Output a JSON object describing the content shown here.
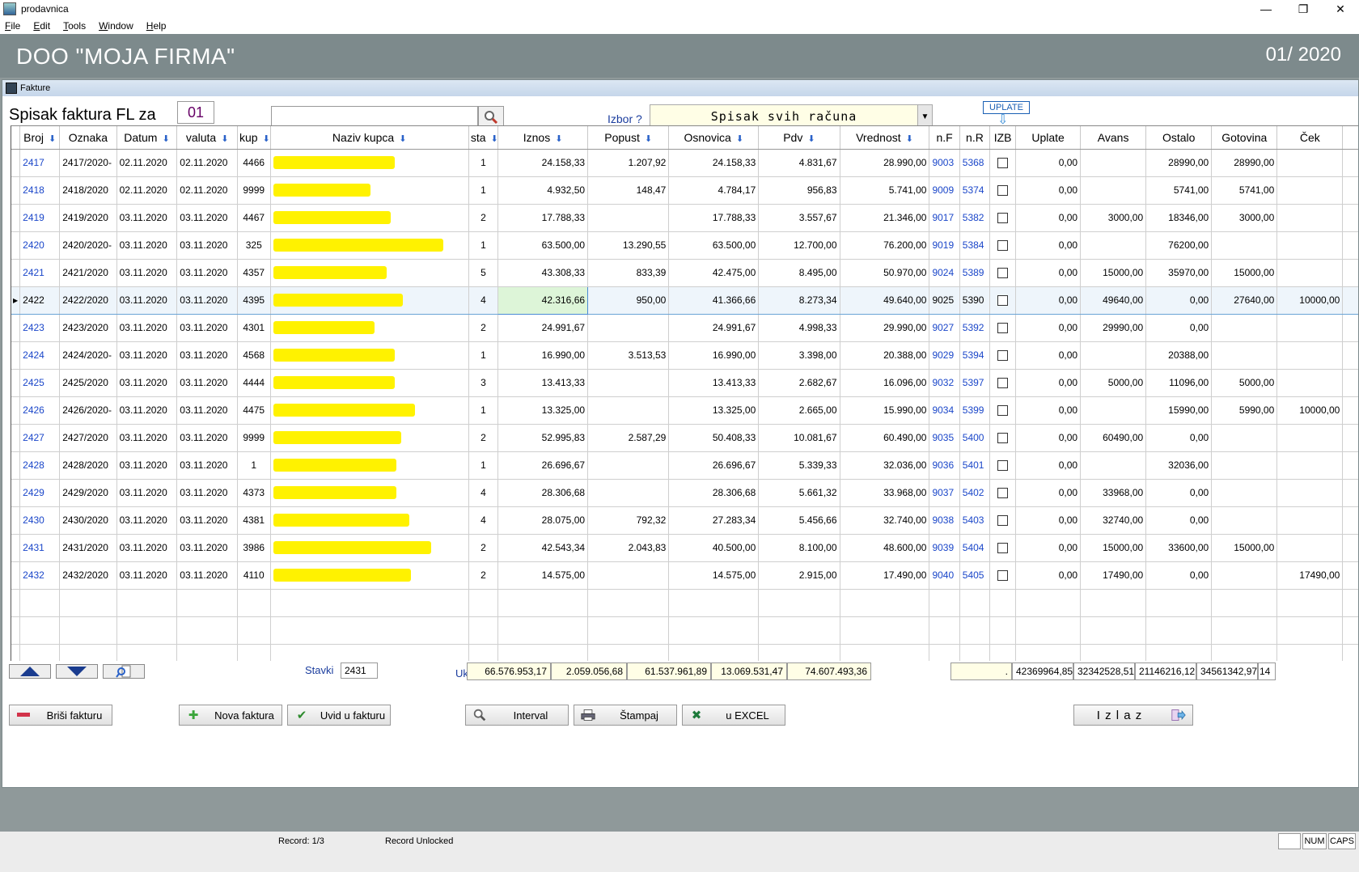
{
  "window": {
    "title": "prodavnica",
    "minimize": "—",
    "restore": "❐",
    "close": "✕"
  },
  "menu": [
    "File",
    "Edit",
    "Tools",
    "Window",
    "Help"
  ],
  "banner": {
    "company": "DOO  \"MOJA FIRMA\"",
    "period": "01/ 2020"
  },
  "child_title": "Fakture",
  "filter": {
    "label": "Spisak faktura FL za",
    "month": "01",
    "search_value": "",
    "izbor_label": "Izbor ?",
    "izbor_value": "Spisak svih računa",
    "uplate_label": "UPLATE"
  },
  "columns": [
    {
      "label": "Broj",
      "sort": true
    },
    {
      "label": "Oznaka",
      "sort": false
    },
    {
      "label": "Datum",
      "sort": true
    },
    {
      "label": "valuta",
      "sort": true
    },
    {
      "label": "kup",
      "sort": true
    },
    {
      "label": "Naziv kupca",
      "sort": true
    },
    {
      "label": "sta",
      "sort": true
    },
    {
      "label": "Iznos",
      "sort": true
    },
    {
      "label": "Popust",
      "sort": true
    },
    {
      "label": "Osnovica",
      "sort": true
    },
    {
      "label": "Pdv",
      "sort": true
    },
    {
      "label": "Vrednost",
      "sort": true
    },
    {
      "label": "n.F",
      "sort": false
    },
    {
      "label": "n.R",
      "sort": false
    },
    {
      "label": "IZB",
      "sort": false
    },
    {
      "label": "Uplate",
      "sort": false
    },
    {
      "label": "Avans",
      "sort": false
    },
    {
      "label": "Ostalo",
      "sort": false
    },
    {
      "label": "Gotovina",
      "sort": false
    },
    {
      "label": "Ček",
      "sort": false
    }
  ],
  "rows": [
    {
      "broj": "2417",
      "oznaka": "2417/2020-",
      "datum": "02.11.2020",
      "valuta": "02.11.2020",
      "kup": "4466",
      "sta": "1",
      "iznos": "24.158,33",
      "popust": "1.207,92",
      "osnovica": "24.158,33",
      "pdv": "4.831,67",
      "vrednost": "28.990,00",
      "nf": "9003",
      "nr": "5368",
      "uplate": "0,00",
      "avans": "",
      "ostalo": "28990,00",
      "gotovina": "28990,00",
      "cek": ""
    },
    {
      "broj": "2418",
      "oznaka": "2418/2020",
      "datum": "02.11.2020",
      "valuta": "02.11.2020",
      "kup": "9999",
      "sta": "1",
      "iznos": "4.932,50",
      "popust": "148,47",
      "osnovica": "4.784,17",
      "pdv": "956,83",
      "vrednost": "5.741,00",
      "nf": "9009",
      "nr": "5374",
      "uplate": "0,00",
      "avans": "",
      "ostalo": "5741,00",
      "gotovina": "5741,00",
      "cek": ""
    },
    {
      "broj": "2419",
      "oznaka": "2419/2020",
      "datum": "03.11.2020",
      "valuta": "03.11.2020",
      "kup": "4467",
      "sta": "2",
      "iznos": "17.788,33",
      "popust": "",
      "osnovica": "17.788,33",
      "pdv": "3.557,67",
      "vrednost": "21.346,00",
      "nf": "9017",
      "nr": "5382",
      "uplate": "0,00",
      "avans": "3000,00",
      "ostalo": "18346,00",
      "gotovina": "3000,00",
      "cek": ""
    },
    {
      "broj": "2420",
      "oznaka": "2420/2020-",
      "datum": "03.11.2020",
      "valuta": "03.11.2020",
      "kup": "325",
      "sta": "1",
      "iznos": "63.500,00",
      "popust": "13.290,55",
      "osnovica": "63.500,00",
      "pdv": "12.700,00",
      "vrednost": "76.200,00",
      "nf": "9019",
      "nr": "5384",
      "uplate": "0,00",
      "avans": "",
      "ostalo": "76200,00",
      "gotovina": "",
      "cek": ""
    },
    {
      "broj": "2421",
      "oznaka": "2421/2020",
      "datum": "03.11.2020",
      "valuta": "03.11.2020",
      "kup": "4357",
      "sta": "5",
      "iznos": "43.308,33",
      "popust": "833,39",
      "osnovica": "42.475,00",
      "pdv": "8.495,00",
      "vrednost": "50.970,00",
      "nf": "9024",
      "nr": "5389",
      "uplate": "0,00",
      "avans": "15000,00",
      "ostalo": "35970,00",
      "gotovina": "15000,00",
      "cek": ""
    },
    {
      "broj": "2422",
      "oznaka": "2422/2020",
      "datum": "03.11.2020",
      "valuta": "03.11.2020",
      "kup": "4395",
      "sta": "4",
      "iznos": "42.316,66",
      "popust": "950,00",
      "osnovica": "41.366,66",
      "pdv": "8.273,34",
      "vrednost": "49.640,00",
      "nf": "9025",
      "nr": "5390",
      "uplate": "0,00",
      "avans": "49640,00",
      "ostalo": "0,00",
      "gotovina": "27640,00",
      "cek": "10000,00",
      "selected": true
    },
    {
      "broj": "2423",
      "oznaka": "2423/2020",
      "datum": "03.11.2020",
      "valuta": "03.11.2020",
      "kup": "4301",
      "sta": "2",
      "iznos": "24.991,67",
      "popust": "",
      "osnovica": "24.991,67",
      "pdv": "4.998,33",
      "vrednost": "29.990,00",
      "nf": "9027",
      "nr": "5392",
      "uplate": "0,00",
      "avans": "29990,00",
      "ostalo": "0,00",
      "gotovina": "",
      "cek": ""
    },
    {
      "broj": "2424",
      "oznaka": "2424/2020-",
      "datum": "03.11.2020",
      "valuta": "03.11.2020",
      "kup": "4568",
      "sta": "1",
      "iznos": "16.990,00",
      "popust": "3.513,53",
      "osnovica": "16.990,00",
      "pdv": "3.398,00",
      "vrednost": "20.388,00",
      "nf": "9029",
      "nr": "5394",
      "uplate": "0,00",
      "avans": "",
      "ostalo": "20388,00",
      "gotovina": "",
      "cek": ""
    },
    {
      "broj": "2425",
      "oznaka": "2425/2020",
      "datum": "03.11.2020",
      "valuta": "03.11.2020",
      "kup": "4444",
      "sta": "3",
      "iznos": "13.413,33",
      "popust": "",
      "osnovica": "13.413,33",
      "pdv": "2.682,67",
      "vrednost": "16.096,00",
      "nf": "9032",
      "nr": "5397",
      "uplate": "0,00",
      "avans": "5000,00",
      "ostalo": "11096,00",
      "gotovina": "5000,00",
      "cek": ""
    },
    {
      "broj": "2426",
      "oznaka": "2426/2020-",
      "datum": "03.11.2020",
      "valuta": "03.11.2020",
      "kup": "4475",
      "sta": "1",
      "iznos": "13.325,00",
      "popust": "",
      "osnovica": "13.325,00",
      "pdv": "2.665,00",
      "vrednost": "15.990,00",
      "nf": "9034",
      "nr": "5399",
      "uplate": "0,00",
      "avans": "",
      "ostalo": "15990,00",
      "gotovina": "5990,00",
      "cek": "10000,00"
    },
    {
      "broj": "2427",
      "oznaka": "2427/2020",
      "datum": "03.11.2020",
      "valuta": "03.11.2020",
      "kup": "9999",
      "sta": "2",
      "iznos": "52.995,83",
      "popust": "2.587,29",
      "osnovica": "50.408,33",
      "pdv": "10.081,67",
      "vrednost": "60.490,00",
      "nf": "9035",
      "nr": "5400",
      "uplate": "0,00",
      "avans": "60490,00",
      "ostalo": "0,00",
      "gotovina": "",
      "cek": ""
    },
    {
      "broj": "2428",
      "oznaka": "2428/2020",
      "datum": "03.11.2020",
      "valuta": "03.11.2020",
      "kup": "1",
      "sta": "1",
      "iznos": "26.696,67",
      "popust": "",
      "osnovica": "26.696,67",
      "pdv": "5.339,33",
      "vrednost": "32.036,00",
      "nf": "9036",
      "nr": "5401",
      "uplate": "0,00",
      "avans": "",
      "ostalo": "32036,00",
      "gotovina": "",
      "cek": ""
    },
    {
      "broj": "2429",
      "oznaka": "2429/2020",
      "datum": "03.11.2020",
      "valuta": "03.11.2020",
      "kup": "4373",
      "sta": "4",
      "iznos": "28.306,68",
      "popust": "",
      "osnovica": "28.306,68",
      "pdv": "5.661,32",
      "vrednost": "33.968,00",
      "nf": "9037",
      "nr": "5402",
      "uplate": "0,00",
      "avans": "33968,00",
      "ostalo": "0,00",
      "gotovina": "",
      "cek": ""
    },
    {
      "broj": "2430",
      "oznaka": "2430/2020",
      "datum": "03.11.2020",
      "valuta": "03.11.2020",
      "kup": "4381",
      "sta": "4",
      "iznos": "28.075,00",
      "popust": "792,32",
      "osnovica": "27.283,34",
      "pdv": "5.456,66",
      "vrednost": "32.740,00",
      "nf": "9038",
      "nr": "5403",
      "uplate": "0,00",
      "avans": "32740,00",
      "ostalo": "0,00",
      "gotovina": "",
      "cek": ""
    },
    {
      "broj": "2431",
      "oznaka": "2431/2020",
      "datum": "03.11.2020",
      "valuta": "03.11.2020",
      "kup": "3986",
      "sta": "2",
      "iznos": "42.543,34",
      "popust": "2.043,83",
      "osnovica": "40.500,00",
      "pdv": "8.100,00",
      "vrednost": "48.600,00",
      "nf": "9039",
      "nr": "5404",
      "uplate": "0,00",
      "avans": "15000,00",
      "ostalo": "33600,00",
      "gotovina": "15000,00",
      "cek": ""
    },
    {
      "broj": "2432",
      "oznaka": "2432/2020",
      "datum": "03.11.2020",
      "valuta": "03.11.2020",
      "kup": "4110",
      "sta": "2",
      "iznos": "14.575,00",
      "popust": "",
      "osnovica": "14.575,00",
      "pdv": "2.915,00",
      "vrednost": "17.490,00",
      "nf": "9040",
      "nr": "5405",
      "uplate": "0,00",
      "avans": "17490,00",
      "ostalo": "0,00",
      "gotovina": "",
      "cek": "17490,00"
    }
  ],
  "empty_rows": 4,
  "footer": {
    "stavki_label": "Stavki",
    "stavki_value": "2431",
    "ukupno_label": "Ukupno",
    "tot_iznos": "66.576.953,17",
    "tot_popust": "2.059.056,68",
    "tot_osnovica": "61.537.961,89",
    "tot_pdv": "13.069.531,47",
    "tot_vrednost": "74.607.493,36",
    "tot_uplate": ".",
    "tot_avans": "42369964,85",
    "tot_ostalo": "32342528,51",
    "tot_gotovina": "21146216,12",
    "tot_cek": "34561342,97",
    "tot_extra": "14"
  },
  "buttons": {
    "brisi": "Briši fakturu",
    "nova": "Nova faktura",
    "uvid": "Uvid u  fakturu",
    "interval": "Interval",
    "stampaj": "Štampaj",
    "excel": "u EXCEL",
    "izlaz": "I z l a z"
  },
  "status": {
    "record": "Record: 1/3",
    "lock": "Record Unlocked",
    "num": "NUM",
    "caps": "CAPS"
  }
}
